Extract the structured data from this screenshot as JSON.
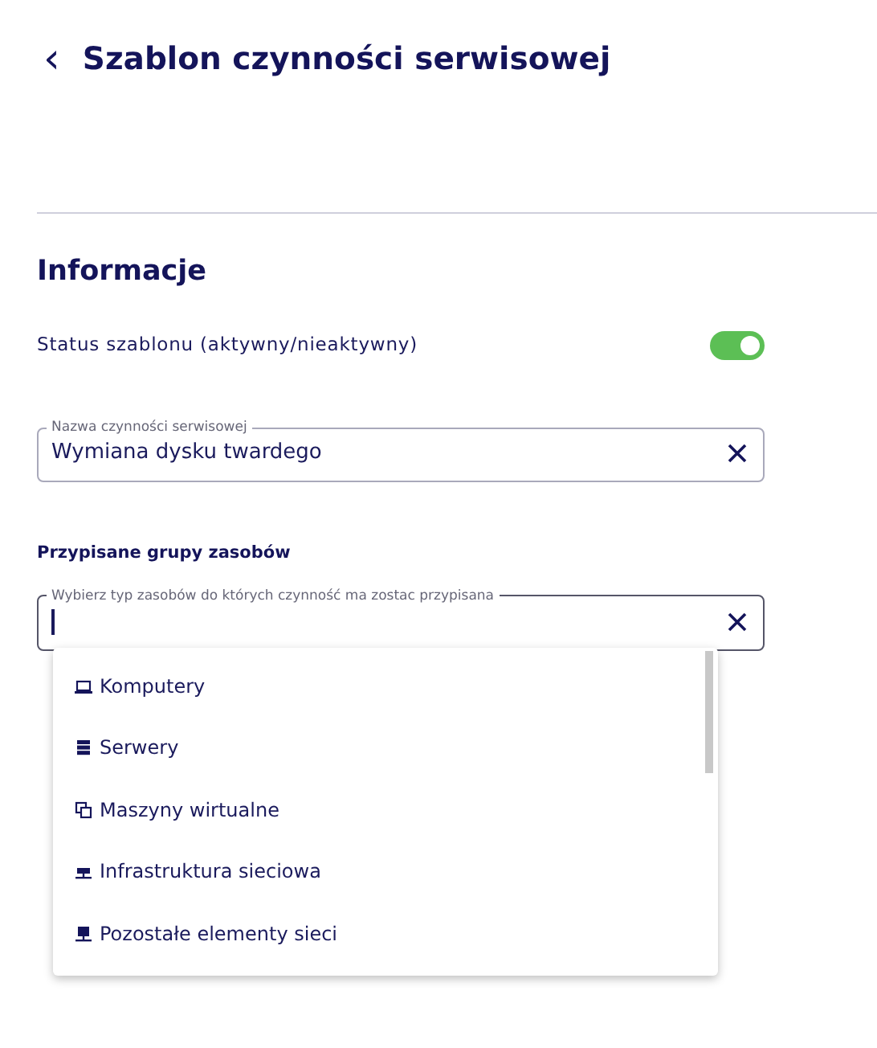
{
  "header": {
    "back": "‹",
    "title": "Szablon czynności serwisowej"
  },
  "section": {
    "title": "Informacje",
    "status": {
      "label": "Status szablonu (aktywny/nieaktywny)",
      "on": true
    },
    "name_field": {
      "label": "Nazwa czynności serwisowej",
      "value": "Wymiana dysku twardego",
      "focused": false
    },
    "groups_title": "Przypisane grupy zasobów",
    "groups_field": {
      "label": "Wybierz typ zasobów do których czynność ma zostac przypisana",
      "focused": true
    },
    "dropdown": {
      "expanded": true,
      "items": [
        {
          "label": "Komputery",
          "kind": "laptop"
        },
        {
          "label": "Serwery",
          "kind": "server"
        },
        {
          "label": "Maszyny wirtualne",
          "kind": "copies"
        },
        {
          "label": "Infrastruktura sieciowa",
          "kind": "network"
        },
        {
          "label": "Pozostałe elementy sieci",
          "kind": "monitor"
        }
      ]
    }
  }
}
